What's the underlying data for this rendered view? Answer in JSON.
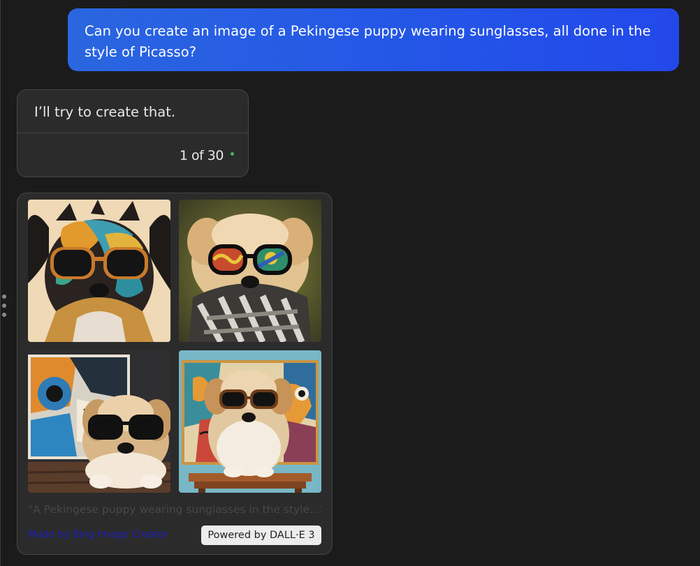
{
  "conversation": {
    "user_message": "Can you create an image of a Pekingese puppy wearing sunglasses, all done in the style of Picasso?",
    "bot_message": "I’ll try to create that.",
    "turn_counter": "1 of 30"
  },
  "image_card": {
    "images": [
      {
        "icon": "pekingese-cubist-portrait"
      },
      {
        "icon": "pekingese-with-scarf"
      },
      {
        "icon": "pekingese-with-cubist-painting"
      },
      {
        "icon": "pekingese-on-table-with-painting"
      }
    ],
    "caption": "\"A Pekingese puppy wearing sunglasses in the style...\"",
    "made_by_label": "Made by Bing Image Creator",
    "powered_label": "Powered by DALL·E 3"
  },
  "colors": {
    "background": "#1b1b1b",
    "user_bubble": "#2352e8",
    "bot_bubble": "#2b2b2b",
    "status_dot": "#3fb950",
    "link": "#1f1fbb"
  }
}
